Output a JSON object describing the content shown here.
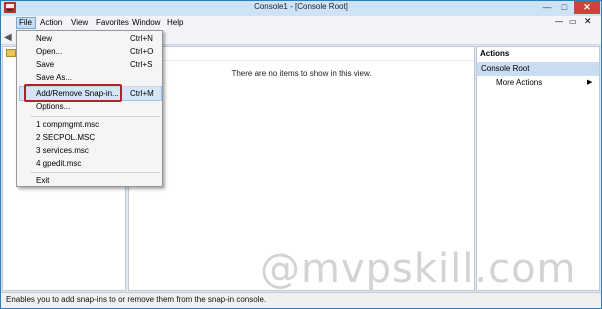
{
  "window": {
    "title": "Console1 - [Console Root]",
    "min_glyph": "—",
    "max_glyph": "□",
    "close_glyph": "✕"
  },
  "menubar": {
    "items": [
      "File",
      "Action",
      "View",
      "Favorites",
      "Window",
      "Help"
    ],
    "mdi_min": "—",
    "mdi_max": "▭",
    "mdi_close": "✕"
  },
  "toolbar": {
    "back_glyph": "◀"
  },
  "content": {
    "empty_message": "There are no items to show in this view."
  },
  "actions": {
    "title": "Actions",
    "section": "Console Root",
    "more_actions": "More Actions",
    "more_arrow": "▶"
  },
  "file_menu": {
    "items": [
      {
        "label": "New",
        "shortcut": "Ctrl+N"
      },
      {
        "label": "Open...",
        "shortcut": "Ctrl+O"
      },
      {
        "label": "Save",
        "shortcut": "Ctrl+S"
      },
      {
        "label": "Save As...",
        "shortcut": ""
      },
      {
        "label": "Add/Remove Snap-in...",
        "shortcut": "Ctrl+M"
      },
      {
        "label": "Options...",
        "shortcut": ""
      },
      {
        "label": "1 compmgmt.msc",
        "shortcut": ""
      },
      {
        "label": "2 SECPOL.MSC",
        "shortcut": ""
      },
      {
        "label": "3 services.msc",
        "shortcut": ""
      },
      {
        "label": "4 gpedit.msc",
        "shortcut": ""
      },
      {
        "label": "Exit",
        "shortcut": ""
      }
    ],
    "highlighted": "Add/Remove Snap-in..."
  },
  "status_bar": {
    "text": "Enables you to add snap-ins to or remove them from the snap-in console."
  },
  "watermark": "@mvpskill.com",
  "colors": {
    "title_bar": "#cfe3f6",
    "close_button": "#c7473c",
    "selection": "#d4e5f7",
    "callout_red": "#b3202a"
  }
}
